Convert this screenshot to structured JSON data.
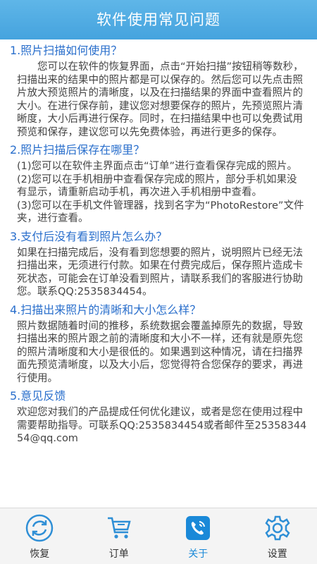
{
  "header": {
    "title": "软件使用常见问题"
  },
  "faq": [
    {
      "question": "1.照片扫描如何使用？",
      "paragraphs": [
        "您可以在软件的恢复界面，点击“开始扫描”按钮稍等数秒，扫描出来的结果中的照片都是可以保存的。然后您可以先点击照片放大预览照片的清晰度，以及在扫描结果的界面中查看照片的大小。在进行保存前，建议您对想要保存的照片，先预览照片清晰度，大小后再进行保存。同时，在扫描结果中也可以免费试用预览和保存，建议您可以先免费体验，再进行更多的保存。"
      ]
    },
    {
      "question": "2.照片扫描后保存在哪里？",
      "paragraphs": [
        "(1)您可以在软件主界面点击“订单”进行查看保存完成的照片。",
        "(2)您可以在手机相册中查看保存完成的照片，部分手机如果没有显示，请重新启动手机，再次进入手机相册中查看。",
        "(3)您可以在手机文件管理器，找到名字为“PhotoRestore”文件夹，进行查看。"
      ]
    },
    {
      "question": "3.支付后没有看到照片怎么办？",
      "paragraphs": [
        "如果在扫描完成后，没有看到您想要的照片，说明照片已经无法扫描出来，无须进行付款。如果在付费完成后，保存照片造成卡死状态，可能会在订单没看到照片，请联系我们的客服进行协助您。联系QQ:2535834454。"
      ]
    },
    {
      "question": "4.扫描出来照片的清晰和大小怎么样？",
      "paragraphs": [
        "照片数据随着时间的推移，系统数据会覆盖掉原先的数据，导致扫描出来的照片跟之前的清晰度和大小不一样，还有就是原先您的照片清晰度和大小是很低的。如果遇到这种情况，请在扫描界面先预览清晰度，以及大小后，您觉得符合您保存的要求，再进行使用。"
      ]
    },
    {
      "question": "5.意见反馈",
      "paragraphs": [
        "欢迎您对我们的产品提成任何优化建议，或者是您在使用过程中需要帮助指导。可联系QQ:2535834454或者邮件至2535834454@qq.com"
      ]
    }
  ],
  "tabs": [
    {
      "label": "恢复",
      "icon": "refresh-icon",
      "active": false
    },
    {
      "label": "订单",
      "icon": "cart-icon",
      "active": false
    },
    {
      "label": "关于",
      "icon": "phone-icon",
      "active": true
    },
    {
      "label": "设置",
      "icon": "gear-icon",
      "active": false
    }
  ],
  "colors": {
    "header": "#4aa8e0",
    "question": "#2a6fcc",
    "active_tab": "#1a89d8"
  }
}
